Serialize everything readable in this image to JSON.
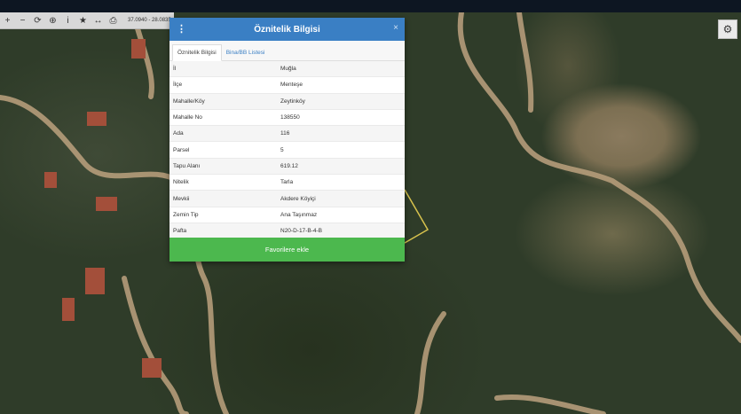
{
  "toolbar": {
    "buttons": [
      {
        "name": "zoom-in",
        "glyph": "+"
      },
      {
        "name": "zoom-out",
        "glyph": "−"
      },
      {
        "name": "refresh",
        "glyph": "⟳"
      },
      {
        "name": "locate",
        "glyph": "⊕"
      },
      {
        "name": "info",
        "glyph": "i"
      },
      {
        "name": "favorite",
        "glyph": "★"
      },
      {
        "name": "measure",
        "glyph": "↔"
      },
      {
        "name": "print",
        "glyph": "⎙"
      }
    ],
    "coords": "37.0940 - 28.0835"
  },
  "gear_glyph": "⚙",
  "panel": {
    "title": "Öznitelik Bilgisi",
    "menu_glyph": "⋮",
    "close_glyph": "×",
    "tabs": [
      "Öznitelik Bilgisi",
      "Bina/BB Listesi"
    ],
    "rows": [
      {
        "key": "İl",
        "value": "Muğla"
      },
      {
        "key": "İlçe",
        "value": "Menteşe"
      },
      {
        "key": "Mahalle/Köy",
        "value": "Zeytinköy"
      },
      {
        "key": "Mahalle No",
        "value": "138550"
      },
      {
        "key": "Ada",
        "value": "116"
      },
      {
        "key": "Parsel",
        "value": "5"
      },
      {
        "key": "Tapu Alanı",
        "value": "619.12"
      },
      {
        "key": "Nitelik",
        "value": "Tarla"
      },
      {
        "key": "Mevkii",
        "value": "Akdere Köyiçi"
      },
      {
        "key": "Zemin Tip",
        "value": "Ana Taşınmaz"
      },
      {
        "key": "Pafta",
        "value": "N20-D-17-B-4-B"
      }
    ],
    "button_label": "Favorilere ekle"
  }
}
